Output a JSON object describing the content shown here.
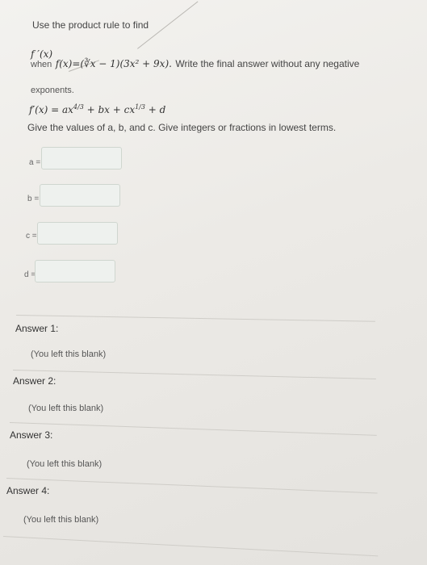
{
  "question": {
    "intro": "Use the product rule to find",
    "target": "f ′(x)",
    "when_prefix": "when",
    "function_expr": "f(x)=(∛x − 1)(3x² + 9x).",
    "instruction": "Write the final answer without any negative",
    "instruction_cont": "exponents.",
    "form_prefix": "f′(x) = ax",
    "form_exp1": "4/3",
    "form_mid": " + bx + cx",
    "form_exp2": "1/3",
    "form_suffix": " + d",
    "prompt": "Give the values of a, b, and c.  Give integers or fractions in lowest terms."
  },
  "fields": [
    {
      "label": "a =",
      "value": ""
    },
    {
      "label": "b =",
      "value": ""
    },
    {
      "label": "c =",
      "value": ""
    },
    {
      "label": "d =",
      "value": ""
    }
  ],
  "answers": [
    {
      "heading": "Answer 1:",
      "note": "(You left this blank)"
    },
    {
      "heading": "Answer 2:",
      "note": "(You left this blank)"
    },
    {
      "heading": "Answer 3:",
      "note": "(You left this blank)"
    },
    {
      "heading": "Answer 4:",
      "note": "(You left this blank)"
    }
  ]
}
